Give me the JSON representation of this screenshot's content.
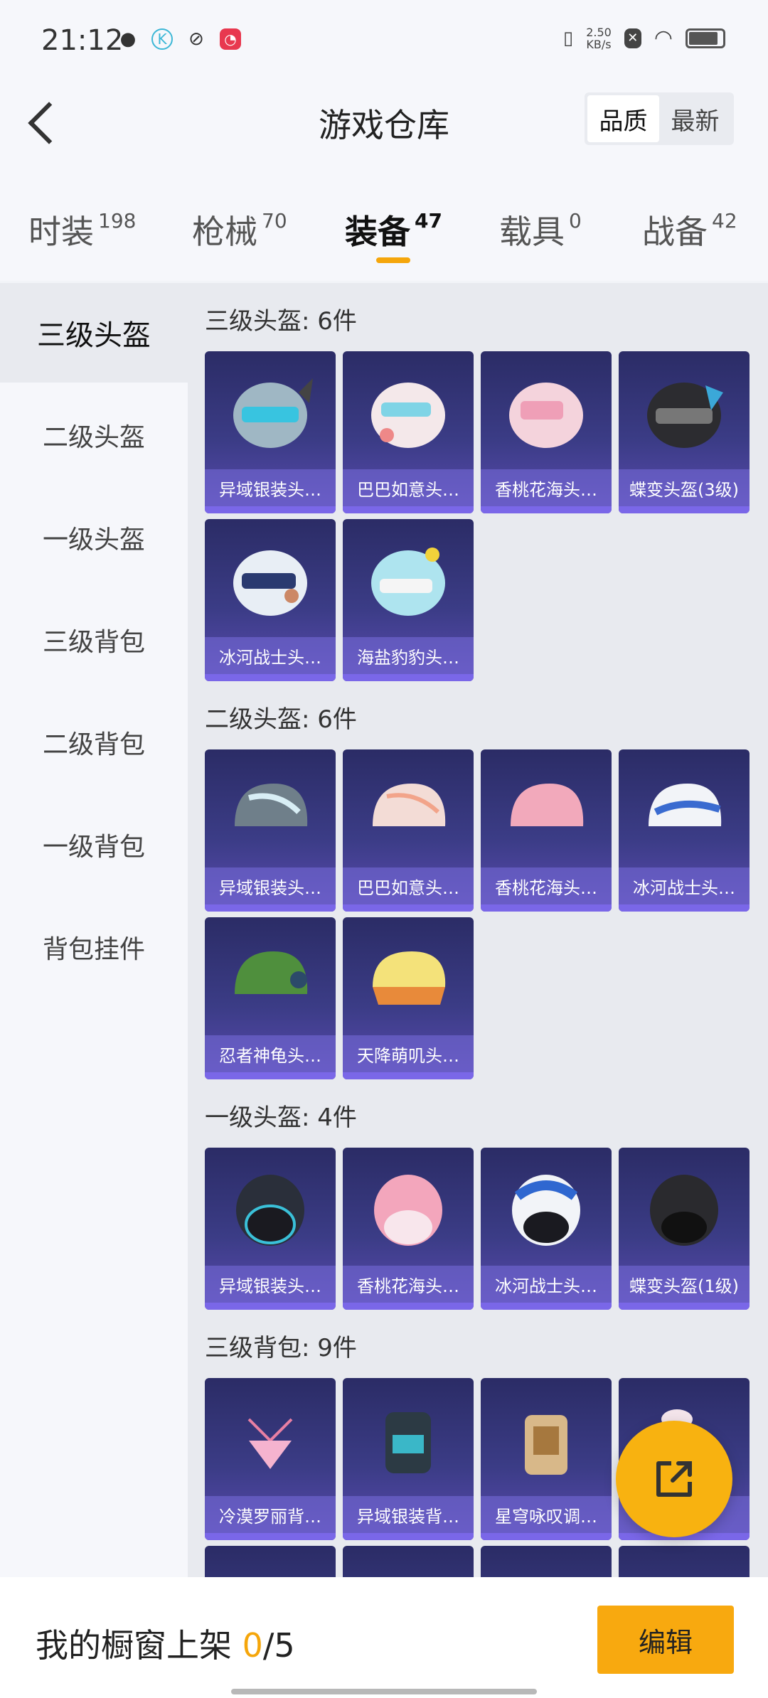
{
  "status": {
    "time": "21:12",
    "net_speed_value": "2.50",
    "net_speed_unit": "KB/s"
  },
  "header": {
    "title": "游戏仓库",
    "sort_options": [
      "品质",
      "最新"
    ],
    "sort_selected": "品质"
  },
  "tabs": [
    {
      "label": "时装",
      "count": "198"
    },
    {
      "label": "枪械",
      "count": "70"
    },
    {
      "label": "装备",
      "count": "47"
    },
    {
      "label": "载具",
      "count": "0"
    },
    {
      "label": "战备",
      "count": "42"
    }
  ],
  "active_tab": "装备",
  "sidebar": {
    "items": [
      "三级头盔",
      "二级头盔",
      "一级头盔",
      "三级背包",
      "二级背包",
      "一级背包",
      "背包挂件"
    ],
    "active": "三级头盔"
  },
  "sections": [
    {
      "title": "三级头盔: 6件",
      "items": [
        "异域银装头…",
        "巴巴如意头…",
        "香桃花海头…",
        "蝶变头盔(3级)",
        "冰河战士头…",
        "海盐豹豹头…"
      ]
    },
    {
      "title": "二级头盔: 6件",
      "items": [
        "异域银装头…",
        "巴巴如意头…",
        "香桃花海头…",
        "冰河战士头…",
        "忍者神龟头…",
        "天降萌叽头…"
      ]
    },
    {
      "title": "一级头盔: 4件",
      "items": [
        "异域银装头…",
        "香桃花海头…",
        "冰河战士头…",
        "蝶变头盔(1级)"
      ]
    },
    {
      "title": "三级背包: 9件",
      "items": [
        "冷漠罗丽背…",
        "异域银装背…",
        "星穹咏叹调…",
        ""
      ]
    }
  ],
  "bottom": {
    "label": "我的橱窗上架 ",
    "current": "0",
    "separator": "/",
    "total": "5",
    "edit_label": "编辑"
  },
  "colors": {
    "accent": "#f5a60b",
    "card_top": "#2b2c66",
    "card_bottom": "#5a4ab0"
  }
}
